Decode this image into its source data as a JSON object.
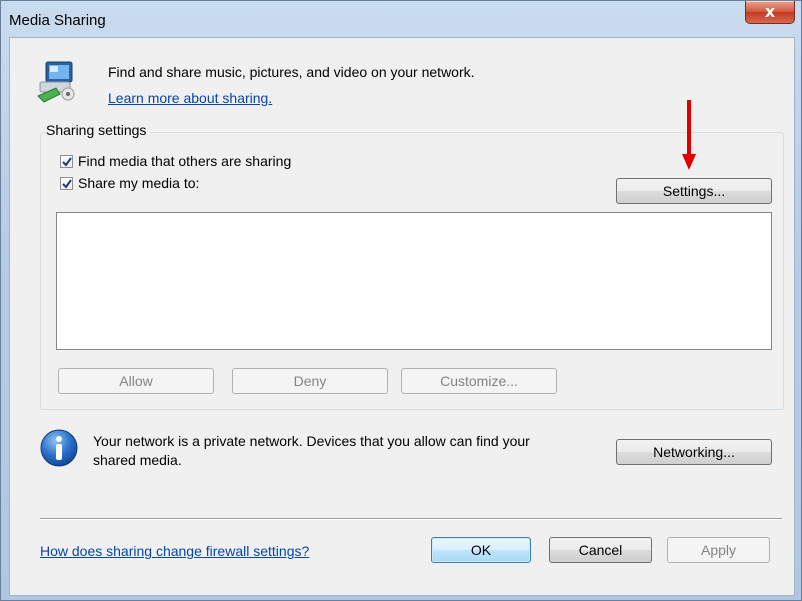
{
  "window": {
    "title": "Media Sharing",
    "close_label": "x"
  },
  "intro": {
    "icon": "media-sharing-icon",
    "text": "Find and share music, pictures, and video on your network.",
    "link": "Learn more about sharing."
  },
  "sharing_settings": {
    "label": "Sharing settings",
    "find_media": {
      "label": "Find media that others are sharing",
      "checked": true
    },
    "share_media": {
      "label": "Share my media to:",
      "checked": true
    },
    "settings_button": "Settings...",
    "device_list": [],
    "allow_button": "Allow",
    "deny_button": "Deny",
    "customize_button": "Customize..."
  },
  "network": {
    "icon": "info-icon",
    "text": "Your network is a private network. Devices that you allow can find your shared media.",
    "networking_button": "Networking..."
  },
  "footer": {
    "firewall_link": "How does sharing change firewall settings?",
    "ok_button": "OK",
    "cancel_button": "Cancel",
    "apply_button": "Apply"
  },
  "annotation": {
    "arrow_color": "#e00000",
    "arrow_icon": "red-down-arrow-icon"
  }
}
